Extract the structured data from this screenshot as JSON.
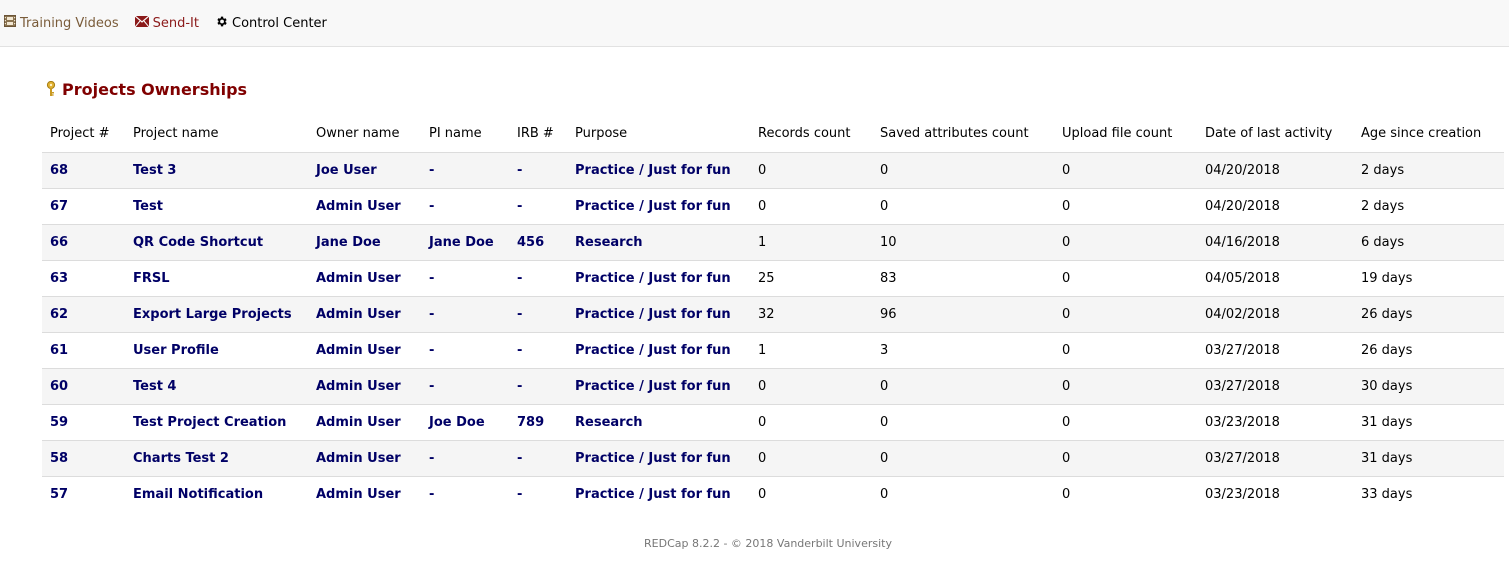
{
  "nav": {
    "training": "Training Videos",
    "sendit": "Send-It",
    "control": "Control Center"
  },
  "page": {
    "title": "Projects Ownerships"
  },
  "table": {
    "headers": {
      "project_num": "Project #",
      "project_name": "Project name",
      "owner_name": "Owner name",
      "pi_name": "PI name",
      "irb": "IRB #",
      "purpose": "Purpose",
      "records_count": "Records count",
      "saved_attributes_count": "Saved attributes count",
      "upload_file_count": "Upload file count",
      "date_last_activity": "Date of last activity",
      "age_since_creation": "Age since creation"
    },
    "rows": [
      {
        "id": "68",
        "name": "Test 3",
        "owner": "Joe User",
        "pi": "-",
        "irb": "-",
        "purpose": "Practice / Just for fun",
        "records": "0",
        "saved": "0",
        "uploads": "0",
        "date": "04/20/2018",
        "age": "2 days"
      },
      {
        "id": "67",
        "name": "Test",
        "owner": "Admin User",
        "pi": "-",
        "irb": "-",
        "purpose": "Practice / Just for fun",
        "records": "0",
        "saved": "0",
        "uploads": "0",
        "date": "04/20/2018",
        "age": "2 days"
      },
      {
        "id": "66",
        "name": "QR Code Shortcut",
        "owner": "Jane Doe",
        "pi": "Jane Doe",
        "irb": "456",
        "purpose": "Research",
        "records": "1",
        "saved": "10",
        "uploads": "0",
        "date": "04/16/2018",
        "age": "6 days"
      },
      {
        "id": "63",
        "name": "FRSL",
        "owner": "Admin User",
        "pi": "-",
        "irb": "-",
        "purpose": "Practice / Just for fun",
        "records": "25",
        "saved": "83",
        "uploads": "0",
        "date": "04/05/2018",
        "age": "19 days"
      },
      {
        "id": "62",
        "name": "Export Large Projects",
        "owner": "Admin User",
        "pi": "-",
        "irb": "-",
        "purpose": "Practice / Just for fun",
        "records": "32",
        "saved": "96",
        "uploads": "0",
        "date": "04/02/2018",
        "age": "26 days"
      },
      {
        "id": "61",
        "name": "User Profile",
        "owner": "Admin User",
        "pi": "-",
        "irb": "-",
        "purpose": "Practice / Just for fun",
        "records": "1",
        "saved": "3",
        "uploads": "0",
        "date": "03/27/2018",
        "age": "26 days"
      },
      {
        "id": "60",
        "name": "Test 4",
        "owner": "Admin User",
        "pi": "-",
        "irb": "-",
        "purpose": "Practice / Just for fun",
        "records": "0",
        "saved": "0",
        "uploads": "0",
        "date": "03/27/2018",
        "age": "30 days"
      },
      {
        "id": "59",
        "name": "Test Project Creation",
        "owner": "Admin User",
        "pi": "Joe Doe",
        "irb": "789",
        "purpose": "Research",
        "records": "0",
        "saved": "0",
        "uploads": "0",
        "date": "03/23/2018",
        "age": "31 days"
      },
      {
        "id": "58",
        "name": "Charts Test 2",
        "owner": "Admin User",
        "pi": "-",
        "irb": "-",
        "purpose": "Practice / Just for fun",
        "records": "0",
        "saved": "0",
        "uploads": "0",
        "date": "03/27/2018",
        "age": "31 days"
      },
      {
        "id": "57",
        "name": "Email Notification",
        "owner": "Admin User",
        "pi": "-",
        "irb": "-",
        "purpose": "Practice / Just for fun",
        "records": "0",
        "saved": "0",
        "uploads": "0",
        "date": "03/23/2018",
        "age": "33 days"
      }
    ]
  },
  "footer": {
    "text": "REDCap 8.2.2 - © 2018 Vanderbilt University"
  },
  "icons": {
    "training": "film-icon",
    "sendit": "envelope-icon",
    "control": "gear-icon",
    "title": "key-icon"
  },
  "colors": {
    "title": "#800000",
    "link": "#000066",
    "nav_bg": "#f8f8f8",
    "row_alt": "#f5f5f5"
  }
}
